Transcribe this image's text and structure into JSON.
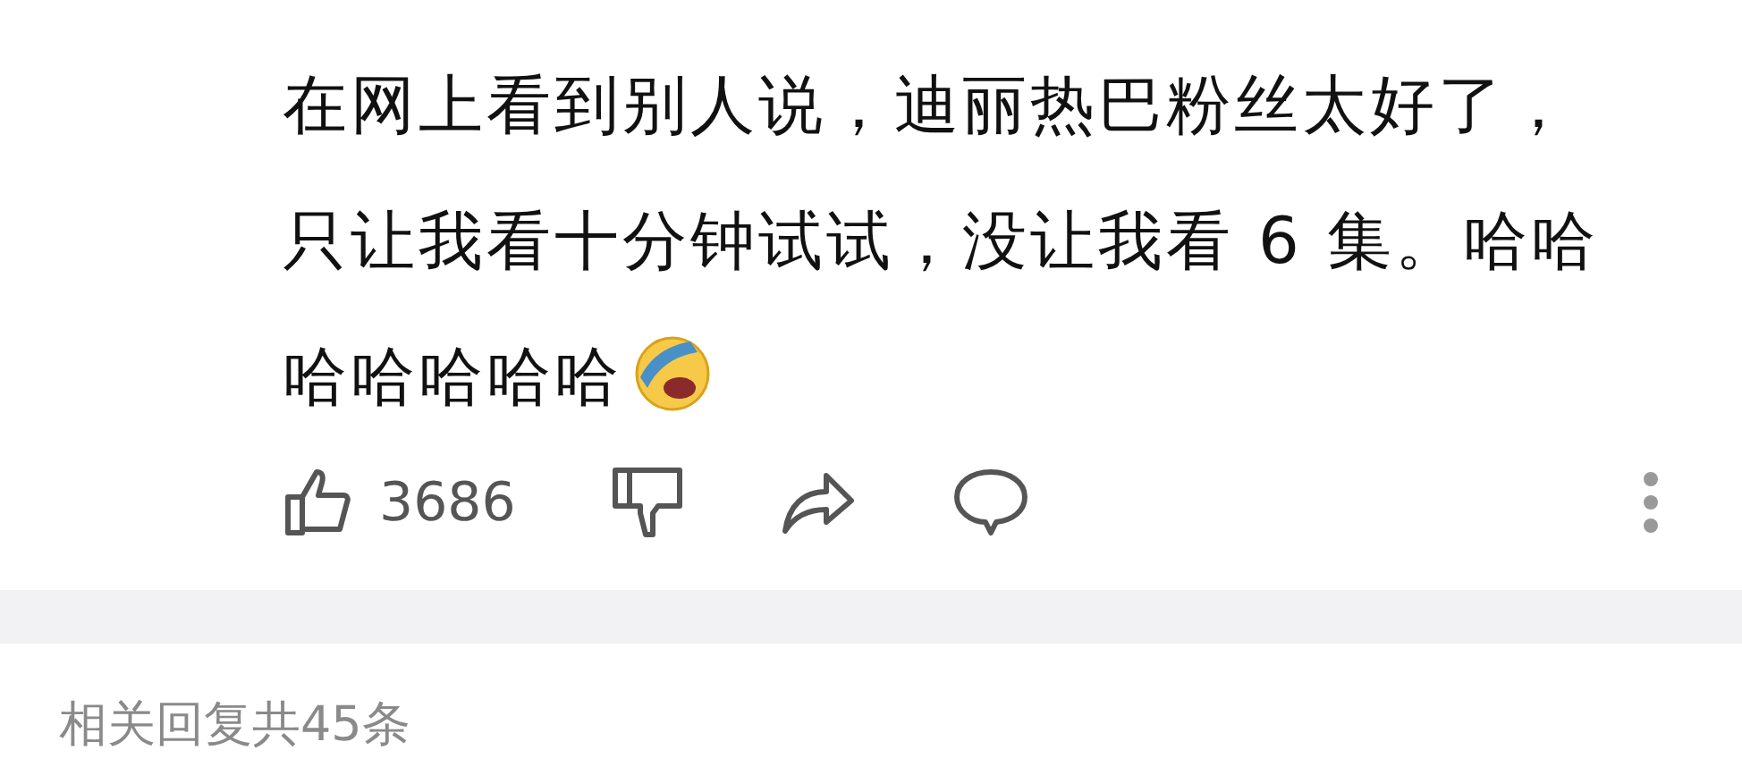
{
  "comment": {
    "text": "在网上看到别人说，迪丽热巴粉丝太好了，只让我看十分钟试试，没让我看 6 集。哈哈哈哈哈哈哈",
    "like_count": "3686"
  },
  "replies": {
    "summary": "相关回复共45条"
  }
}
